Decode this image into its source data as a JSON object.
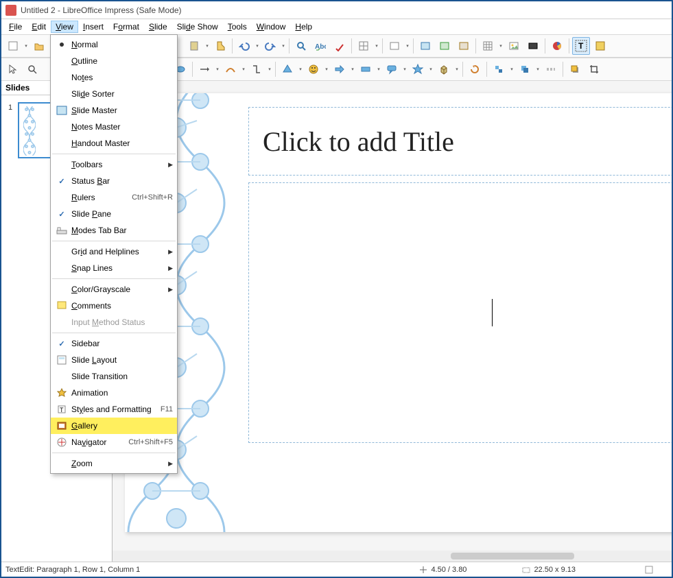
{
  "window": {
    "title": "Untitled 2 - LibreOffice Impress (Safe Mode)"
  },
  "menubar": {
    "file": "File",
    "edit": "Edit",
    "view": "View",
    "insert": "Insert",
    "format": "Format",
    "slide": "Slide",
    "slideshow": "Slide Show",
    "tools": "Tools",
    "window": "Window",
    "help": "Help"
  },
  "view_menu": {
    "normal": "Normal",
    "outline": "Outline",
    "notes": "Notes",
    "slide_sorter": "Slide Sorter",
    "slide_master": "Slide Master",
    "notes_master": "Notes Master",
    "handout_master": "Handout Master",
    "toolbars": "Toolbars",
    "status_bar": "Status Bar",
    "rulers": "Rulers",
    "rulers_accel": "Ctrl+Shift+R",
    "slide_pane": "Slide Pane",
    "modes_tab_bar": "Modes Tab Bar",
    "grid_helplines": "Grid and Helplines",
    "snap_lines": "Snap Lines",
    "color_grayscale": "Color/Grayscale",
    "comments": "Comments",
    "ime_status": "Input Method Status",
    "sidebar": "Sidebar",
    "slide_layout": "Slide Layout",
    "slide_transition": "Slide Transition",
    "animation": "Animation",
    "styles_formatting": "Styles and Formatting",
    "styles_accel": "F11",
    "gallery": "Gallery",
    "navigator": "Navigator",
    "navigator_accel": "Ctrl+Shift+F5",
    "zoom": "Zoom"
  },
  "slides_panel": {
    "title": "Slides",
    "thumb1_num": "1"
  },
  "canvas": {
    "title_placeholder": "Click to add Title"
  },
  "statusbar": {
    "left": "TextEdit: Paragraph 1, Row 1, Column 1",
    "pos": "4.50 / 3.80",
    "size": "22.50 x 9.13"
  }
}
